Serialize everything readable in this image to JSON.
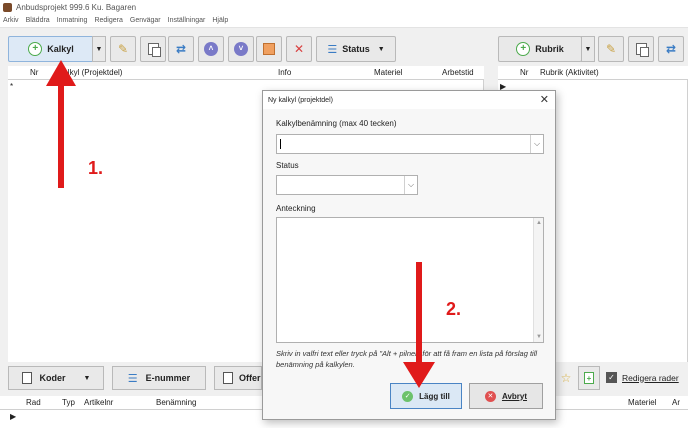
{
  "window": {
    "title": "Anbudsprojekt 999.6 Ku. Bagaren"
  },
  "menu": [
    "Arkiv",
    "Bläddra",
    "Inmatning",
    "Redigera",
    "Genvägar",
    "Inställningar",
    "Hjälp"
  ],
  "toolbar": {
    "kalkyl_label": "Kalkyl",
    "status_label": "Status",
    "rubrik_label": "Rubrik"
  },
  "left_grid": {
    "columns": [
      "Nr",
      "Kalkyl (Projektdel)",
      "Info",
      "Materiel",
      "Arbetstid"
    ],
    "row_marker": "*"
  },
  "right_grid": {
    "columns": [
      "Nr",
      "Rubrik (Aktivitet)"
    ],
    "row_marker": "▶"
  },
  "bottom_toolbar": {
    "koder_label": "Koder",
    "enummer_label": "E-nummer",
    "offert_label": "Offer",
    "redigera_rader_label": "Redigera rader"
  },
  "bottom_grid": {
    "columns": [
      "Rad",
      "Typ",
      "Artikelnr",
      "Benämning",
      "Materiel",
      "Ar"
    ],
    "row_marker": "▶"
  },
  "dialog": {
    "title": "Ny kalkyl (projektdel)",
    "name_label": "Kalkylbenämning (max 40 tecken)",
    "name_value": "",
    "status_label": "Status",
    "status_value": "",
    "note_label": "Anteckning",
    "note_value": "",
    "hint": "Skriv in valfri text eller tryck på \"Alt + pilner\" för att få fram en lista på förslag till benämning på kalkylen.",
    "add_label": "Lägg till",
    "cancel_label": "Avbryt"
  },
  "annotations": {
    "step1": "1.",
    "step2": "2."
  },
  "colors": {
    "annotation_red": "#e01a1a",
    "primary_border": "#4a84c4"
  }
}
